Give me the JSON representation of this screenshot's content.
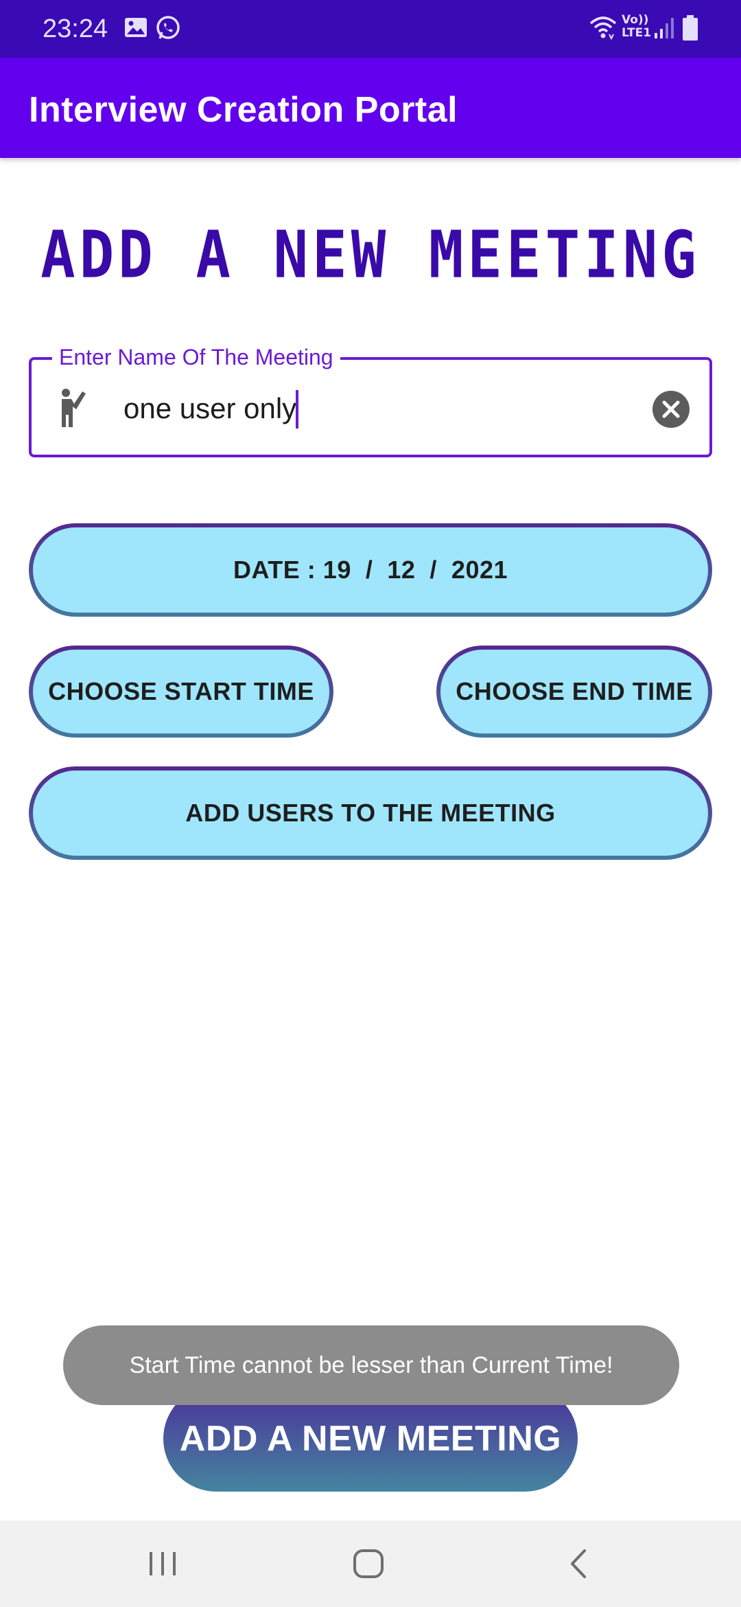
{
  "status_bar": {
    "time": "23:24",
    "icons": [
      "gallery-icon",
      "whatsapp-icon",
      "wifi-icon",
      "volte-lte-icon",
      "signal-icon",
      "battery-icon"
    ],
    "volte_label": "Vo))",
    "lte_label": "LTE1"
  },
  "app_bar": {
    "title": "Interview Creation Portal"
  },
  "main": {
    "heading": "ADD A NEW MEETING",
    "name_field": {
      "label": "Enter Name Of The Meeting",
      "value": "one user only",
      "leading_icon": "person-icon",
      "trailing_icon": "clear-icon"
    },
    "date_button": {
      "prefix": "DATE : ",
      "day": "19",
      "sep1": "  /  ",
      "month": "12",
      "sep2": "  /  ",
      "year": "2021"
    },
    "start_time_button": "CHOOSE START TIME",
    "end_time_button": "CHOOSE END TIME",
    "add_users_button": "ADD USERS TO THE MEETING",
    "submit_button": "ADD A NEW MEETING"
  },
  "toast": {
    "message": "Start Time cannot be lesser than Current Time!"
  },
  "nav_bar": {
    "icons": [
      "recent-apps-icon",
      "home-icon",
      "back-icon"
    ]
  },
  "colors": {
    "status_bar": "#3a0ab4",
    "app_bar": "#6200ee",
    "heading": "#3a0aa8",
    "pill_fill": "#9fe6fc",
    "pill_border_top": "#55278f",
    "pill_border_bottom": "#447aa0",
    "toast_bg": "#8c8c8c"
  }
}
